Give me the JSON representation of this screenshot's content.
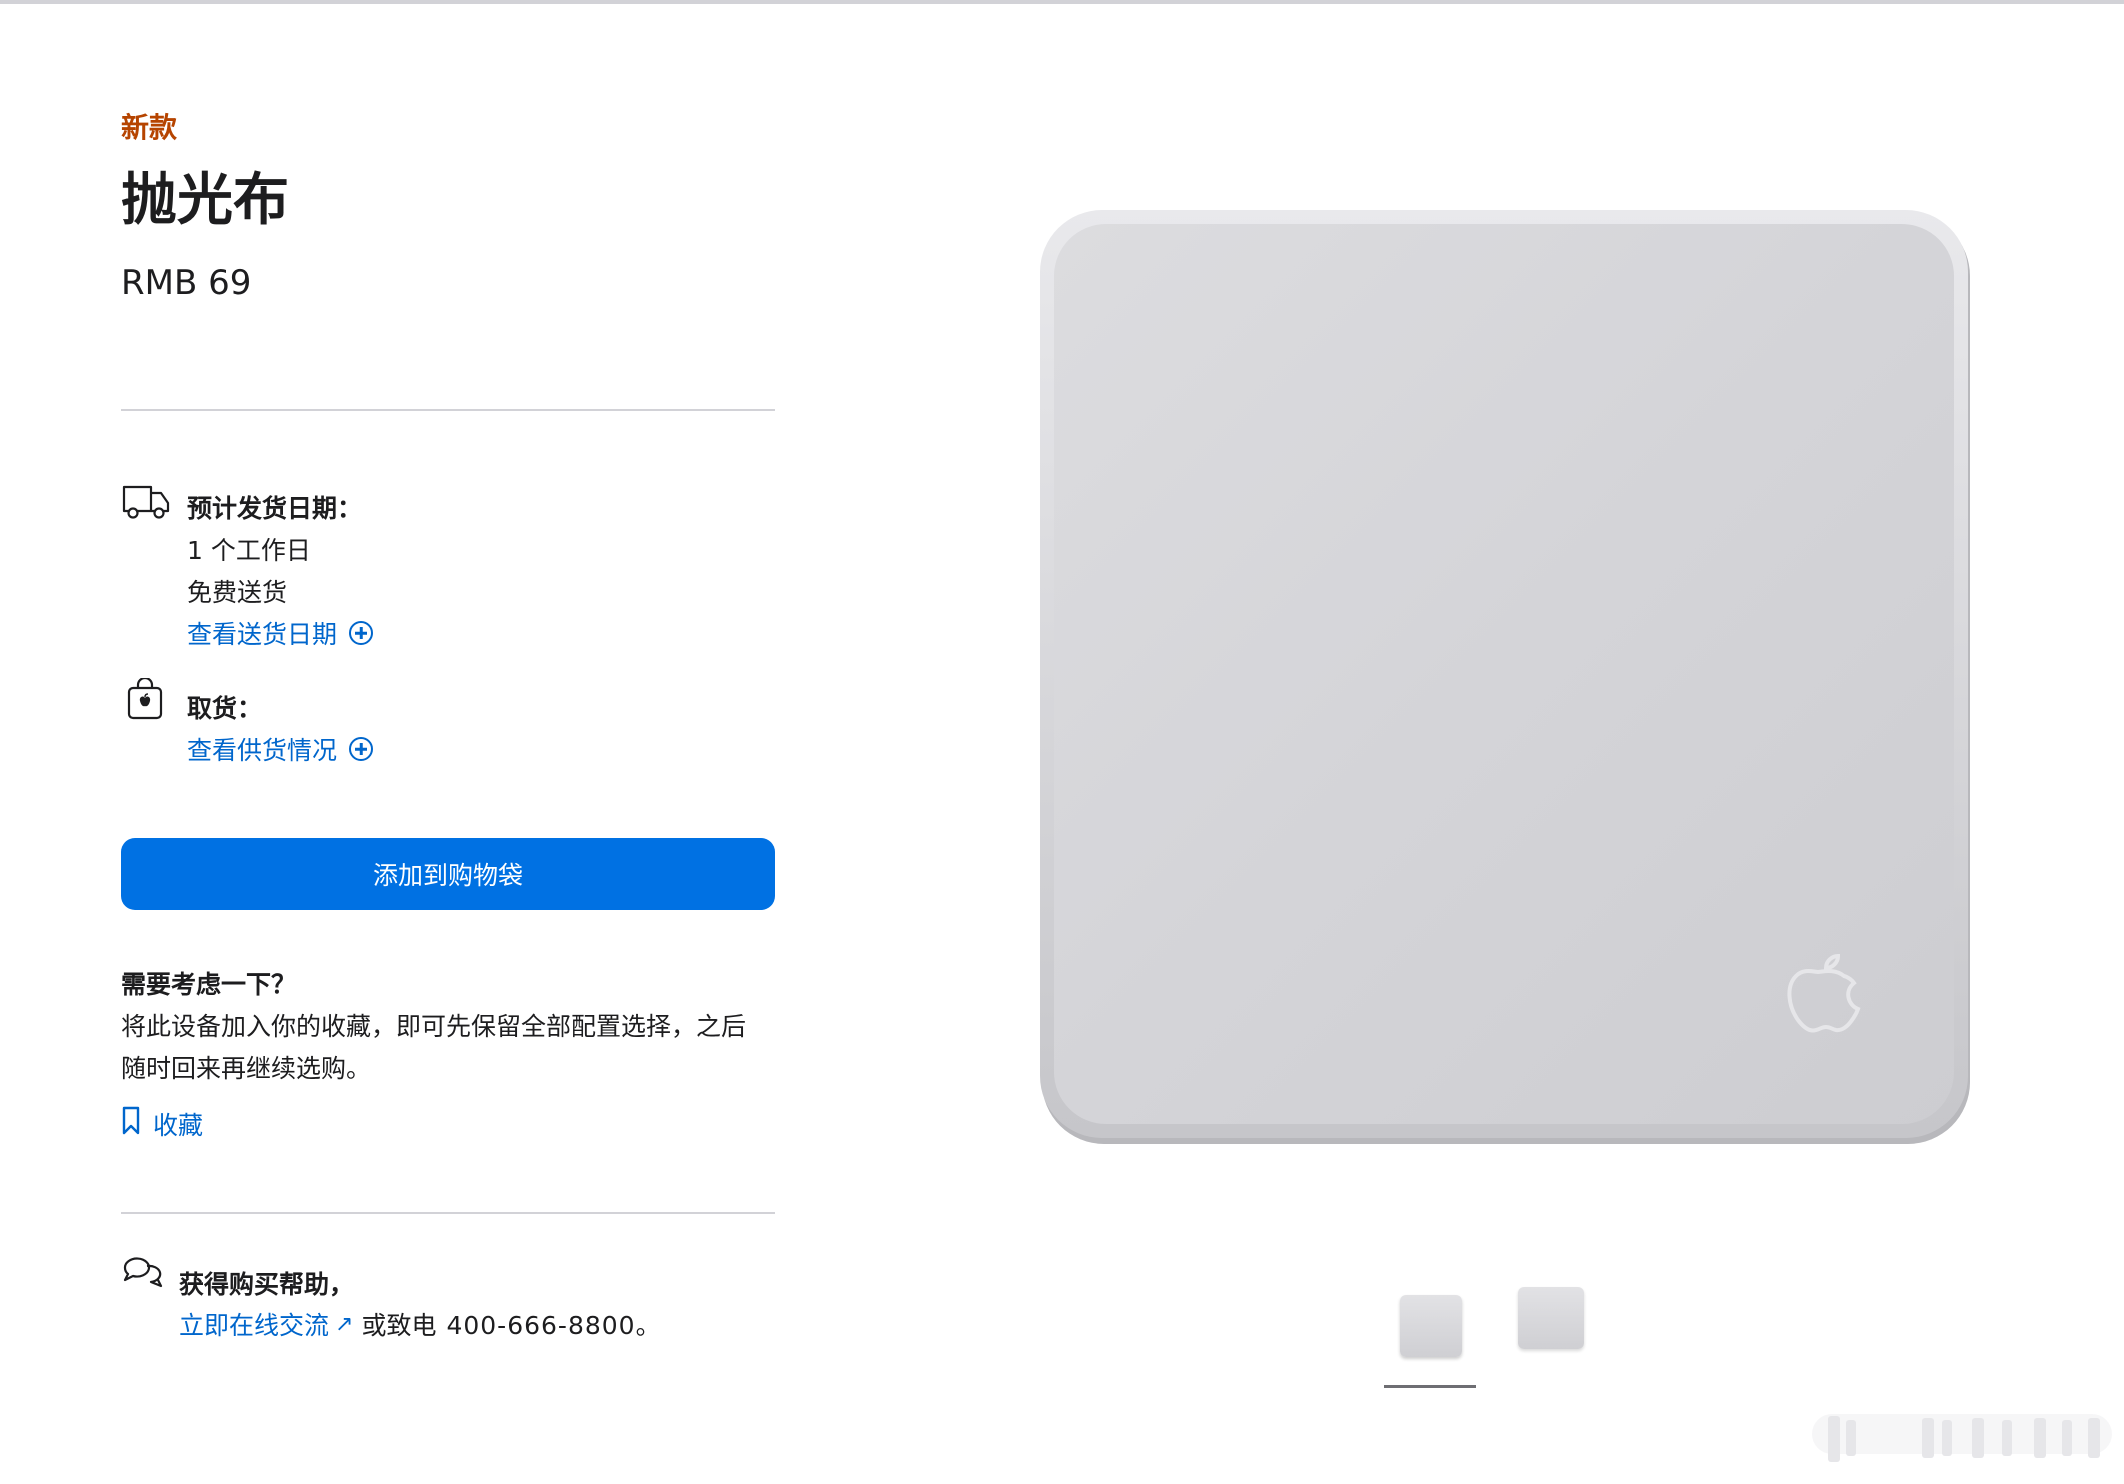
{
  "product": {
    "badge": "新款",
    "title": "抛光布",
    "price": "RMB 69"
  },
  "shipping": {
    "label": "预计发货日期：",
    "days": "1 个工作日",
    "free": "免费送货",
    "link": "查看送货日期"
  },
  "pickup": {
    "label": "取货：",
    "link": "查看供货情况"
  },
  "actions": {
    "add_to_bag": "添加到购物袋"
  },
  "consider": {
    "title": "需要考虑一下？",
    "line1": "将此设备加入你的收藏，即可先保留全部配置选择，之后",
    "line2": "随时回来再继续选购。",
    "save": "收藏"
  },
  "help": {
    "title": "获得购买帮助，",
    "chat_link": "立即在线交流",
    "or_call": "或致电",
    "phone": "400-666-8800。"
  },
  "icons": {
    "truck": "truck-icon",
    "bag": "apple-bag-icon",
    "plus": "plus-circle-icon",
    "bookmark": "bookmark-icon",
    "chat": "chat-bubbles-icon",
    "external": "external-arrow-icon",
    "apple_logo": "apple-logo-icon"
  },
  "colors": {
    "accent": "#0071e3",
    "link": "#0066cc",
    "badge": "#b64400",
    "text": "#1d1d1f"
  }
}
